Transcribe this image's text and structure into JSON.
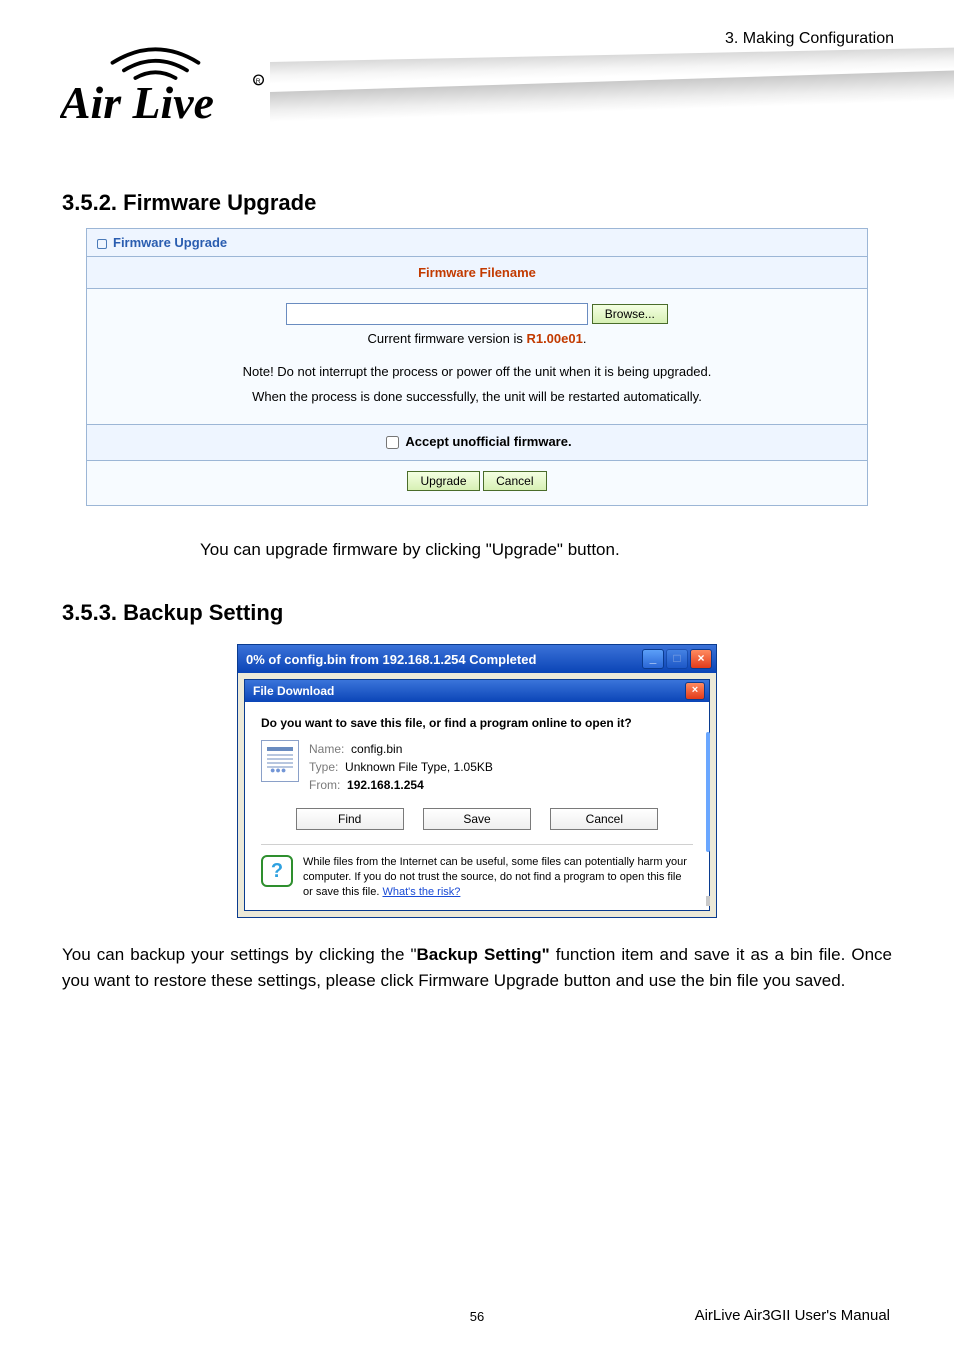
{
  "header": {
    "section_path": "3. Making Configuration"
  },
  "headings": {
    "firmware": "3.5.2.  Firmware Upgrade",
    "backup": "3.5.3.  Backup Setting"
  },
  "firmware_panel": {
    "panel_label": "Firmware Upgrade",
    "filename_heading": "Firmware Filename",
    "browse_label": "Browse...",
    "version_prefix": "Current firmware version is   ",
    "version_value": "R1.00e01",
    "version_suffix": ".",
    "note1": "Note! Do not interrupt the process or power off the unit when it is being upgraded.",
    "note2": "When the process is done successfully, the unit will be restarted automatically.",
    "accept_label": "Accept unofficial firmware.",
    "upgrade_label": "Upgrade",
    "cancel_label": "Cancel"
  },
  "paragraphs": {
    "p1": "You can upgrade firmware by clicking \"Upgrade\" button.",
    "p2_a": "You can backup your settings by clicking the \"",
    "p2_b_bold": "Backup Setting\"",
    "p2_c": " function item and save it as a bin file. Once you want to restore these settings, please click Firmware Upgrade button and use the bin file you saved."
  },
  "progress_window": {
    "title": "0% of config.bin from 192.168.1.254 Completed"
  },
  "file_download_dialog": {
    "title": "File Download",
    "question": "Do you want to save this file, or find a program online to open it?",
    "name_key": "Name:",
    "name_value": "config.bin",
    "type_key": "Type:",
    "type_value": "Unknown File Type, 1.05KB",
    "from_key": "From:",
    "from_value": "192.168.1.254",
    "find_label": "Find",
    "save_label": "Save",
    "cancel_label": "Cancel",
    "warning_text": "While files from the Internet can be useful, some files can potentially harm your computer. If you do not trust the source, do not find a program to open this file or save this file. ",
    "risk_link": "What's the risk?"
  },
  "footer": {
    "page_number": "56",
    "manual": "AirLive Air3GII User's Manual"
  }
}
